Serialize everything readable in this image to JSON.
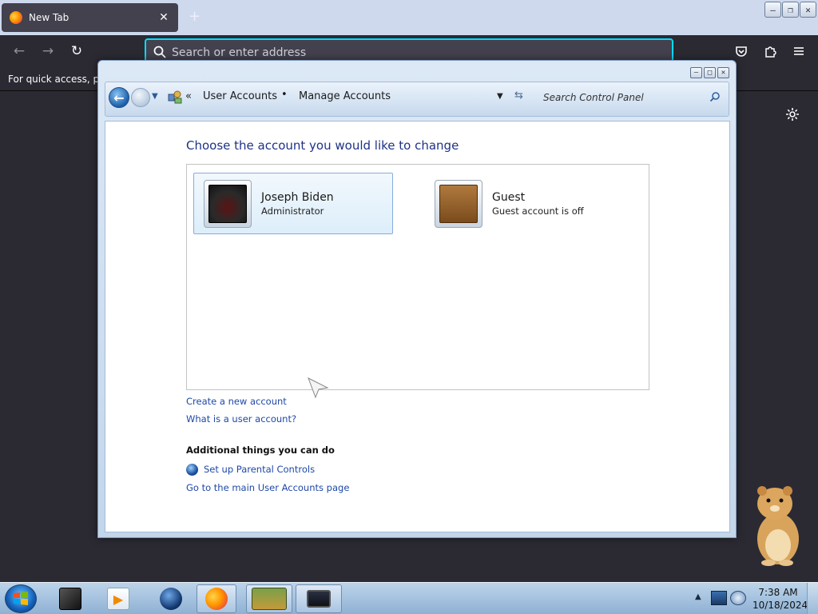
{
  "browser": {
    "tab_title": "New Tab",
    "tab_close": "✕",
    "new_tab": "+",
    "url_placeholder": "Search or enter address",
    "bookmarks_hint": "For quick access, plac",
    "icons": {
      "back": "back-arrow-icon",
      "forward": "forward-arrow-icon",
      "reload": "reload-icon",
      "pocket": "pocket-icon",
      "extensions": "extensions-icon",
      "menu": "hamburger-menu-icon",
      "settings": "gear-icon"
    }
  },
  "control_panel": {
    "breadcrumb": {
      "prefix": "«",
      "items": [
        "User Accounts",
        "Manage Accounts"
      ],
      "separator": "•"
    },
    "search_placeholder": "Search Control Panel",
    "heading": "Choose the account you would like to change",
    "accounts": [
      {
        "name": "Joseph Biden",
        "role": "Administrator",
        "selected": true,
        "picture": "dark-screen-avatar"
      },
      {
        "name": "Guest",
        "role": "Guest account is off",
        "selected": false,
        "picture": "briefcase-avatar"
      }
    ],
    "links": {
      "create": "Create a new account",
      "what_is": "What is a user account?"
    },
    "additional": {
      "heading": "Additional things you can do",
      "parental": "Set up Parental Controls",
      "main_page": "Go to the main User Accounts page"
    }
  },
  "taskbar": {
    "clock_time": "7:38 AM",
    "clock_date": "10/18/2024",
    "apps": [
      "app-dark-box",
      "media-player",
      "globe-app",
      "firefox",
      "box-game",
      "monitor-app"
    ]
  },
  "colors": {
    "firefox_bg": "#2b2a33",
    "url_focus": "#00ddff",
    "link_blue": "#1e48a8",
    "heading_blue": "#1e3287"
  }
}
